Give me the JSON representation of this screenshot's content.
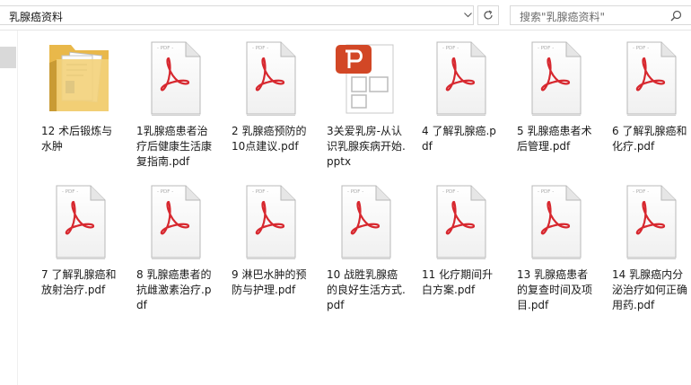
{
  "address_bar": {
    "path": "乳腺癌资料"
  },
  "search": {
    "placeholder": "搜索\"乳腺癌资料\""
  },
  "files": [
    {
      "name": "12 术后锻炼与水肿",
      "type": "folder"
    },
    {
      "name": "1乳腺癌患者治疗后健康生活康复指南.pdf",
      "type": "pdf"
    },
    {
      "name": "2 乳腺癌预防的10点建议.pdf",
      "type": "pdf"
    },
    {
      "name": "3关爱乳房-从认识乳腺疾病开始.pptx",
      "type": "pptx"
    },
    {
      "name": "4 了解乳腺癌.pdf",
      "type": "pdf"
    },
    {
      "name": "5 乳腺癌患者术后管理.pdf",
      "type": "pdf"
    },
    {
      "name": "6 了解乳腺癌和化疗.pdf",
      "type": "pdf"
    },
    {
      "name": "7 了解乳腺癌和放射治疗.pdf",
      "type": "pdf"
    },
    {
      "name": "8 乳腺癌患者的抗雌激素治疗.pdf",
      "type": "pdf"
    },
    {
      "name": "9 淋巴水肿的预防与护理.pdf",
      "type": "pdf"
    },
    {
      "name": "10 战胜乳腺癌的良好生活方式.pdf",
      "type": "pdf"
    },
    {
      "name": "11 化疗期间升白方案.pdf",
      "type": "pdf"
    },
    {
      "name": "13 乳腺癌患者的复查时间及项目.pdf",
      "type": "pdf"
    },
    {
      "name": "14 乳腺癌内分泌治疗如何正确用药.pdf",
      "type": "pdf"
    }
  ],
  "icon_text": {
    "pdf_header": "PDF"
  },
  "colors": {
    "pdf_red": "#d7282f",
    "pptx_orange": "#d24726",
    "folder": "#f3d27a"
  }
}
